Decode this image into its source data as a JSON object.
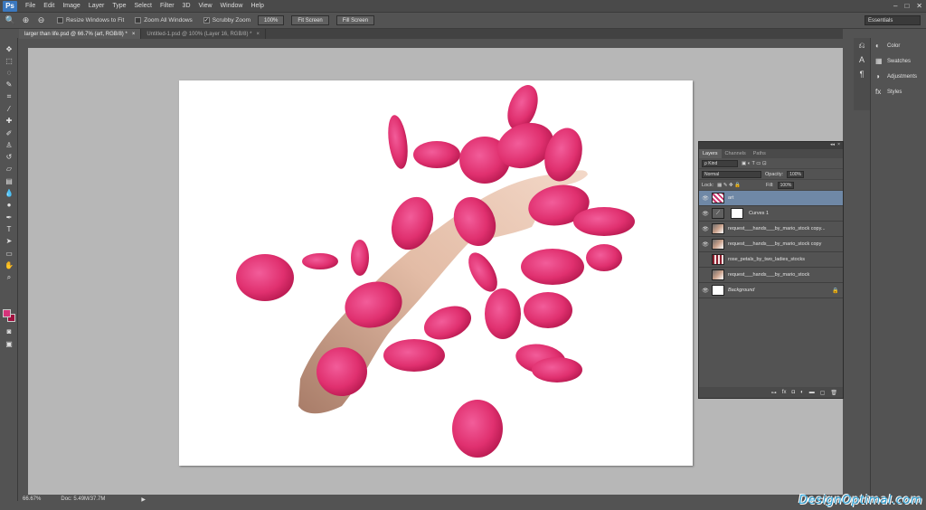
{
  "app": {
    "logo": "Ps",
    "window_controls": [
      "–",
      "□",
      "✕"
    ]
  },
  "menu": [
    "File",
    "Edit",
    "Image",
    "Layer",
    "Type",
    "Select",
    "Filter",
    "3D",
    "View",
    "Window",
    "Help"
  ],
  "options": {
    "resize_windows": "Resize Windows to Fit",
    "zoom_all": "Zoom All Windows",
    "scrubby_zoom": "Scrubby Zoom",
    "btn_100": "100%",
    "fit_screen": "Fit Screen",
    "fill_screen": "Fill Screen",
    "workspace": "Essentials"
  },
  "tabs": [
    {
      "label": "larger than life.psd @ 66.7% (art, RGB/8) *"
    },
    {
      "label": "Untitled-1.psd @ 100% (Layer 16, RGB/8) *"
    }
  ],
  "status": {
    "zoom": "66.67%",
    "doc": "Doc: 5.49M/37.7M"
  },
  "right_panels": [
    {
      "icon": "color-icon",
      "label": "Color"
    },
    {
      "icon": "swatches-icon",
      "label": "Swatches"
    },
    {
      "icon": "adjustments-icon",
      "label": "Adjustments"
    },
    {
      "icon": "styles-icon",
      "label": "Styles"
    }
  ],
  "layers_panel": {
    "tabs": [
      "Layers",
      "Channels",
      "Paths"
    ],
    "kind": "ρ Kind",
    "blend_mode": "Normal",
    "opacity_label": "Opacity:",
    "opacity": "100%",
    "lock_label": "Lock:",
    "fill_label": "Fill:",
    "fill": "100%",
    "layers": [
      {
        "name": "art",
        "visible": true,
        "selected": true
      },
      {
        "name": "Curves 1",
        "visible": true
      },
      {
        "name": "request___hands___by_mario_stock copy...",
        "visible": true
      },
      {
        "name": "request___hands___by_mario_stock copy",
        "visible": true
      },
      {
        "name": "rose_petals_by_two_ladies_stocks",
        "visible": false
      },
      {
        "name": "request___hands___by_mario_stock",
        "visible": false
      },
      {
        "name": "Background",
        "visible": true,
        "locked": true
      }
    ]
  },
  "watermark": "DesignOptimal.com"
}
